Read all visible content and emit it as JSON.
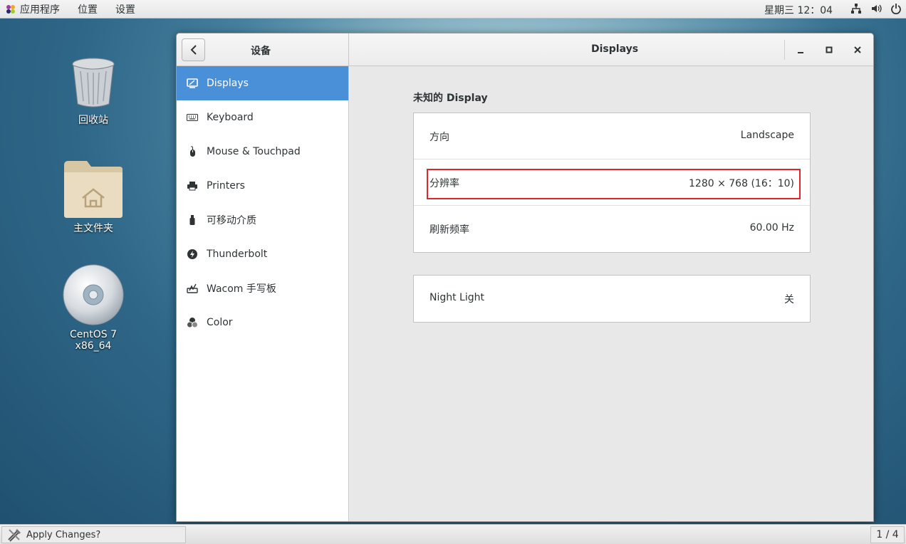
{
  "topbar": {
    "menu": [
      "应用程序",
      "位置",
      "设置"
    ],
    "clock": "星期三 12：04",
    "tray_icons": [
      "network-icon",
      "volume-icon",
      "power-icon"
    ]
  },
  "desktop": {
    "icons": [
      {
        "label": "回收站",
        "icon": "trash-icon"
      },
      {
        "label": "主文件夹",
        "icon": "home-folder-icon"
      },
      {
        "label": "CentOS 7 x86_64",
        "icon": "disc-icon"
      }
    ]
  },
  "window": {
    "sidebar_title": "设备",
    "content_title": "Displays",
    "sidebar_items": [
      {
        "label": "Displays",
        "icon": "display-icon",
        "active": true
      },
      {
        "label": "Keyboard",
        "icon": "keyboard-icon",
        "active": false
      },
      {
        "label": "Mouse & Touchpad",
        "icon": "mouse-icon",
        "active": false
      },
      {
        "label": "Printers",
        "icon": "printer-icon",
        "active": false
      },
      {
        "label": "可移动介质",
        "icon": "usb-drive-icon",
        "active": false
      },
      {
        "label": "Thunderbolt",
        "icon": "thunderbolt-icon",
        "active": false
      },
      {
        "label": "Wacom 手写板",
        "icon": "tablet-icon",
        "active": false
      },
      {
        "label": "Color",
        "icon": "color-icon",
        "active": false
      }
    ],
    "display_section": {
      "title": "未知的  Display",
      "rows": [
        {
          "label": "方向",
          "value": "Landscape"
        },
        {
          "label": "分辨率",
          "value": "1280 × 768 (16：10)"
        },
        {
          "label": "刷新频率",
          "value": "60.00 Hz"
        }
      ]
    },
    "night_light": {
      "label": "Night Light",
      "value": "关"
    }
  },
  "bottombar": {
    "task_label": "Apply Changes?",
    "workspace": "1 / 4"
  },
  "colors": {
    "accent": "#4a90d9",
    "highlight_box": "#e0242c"
  }
}
